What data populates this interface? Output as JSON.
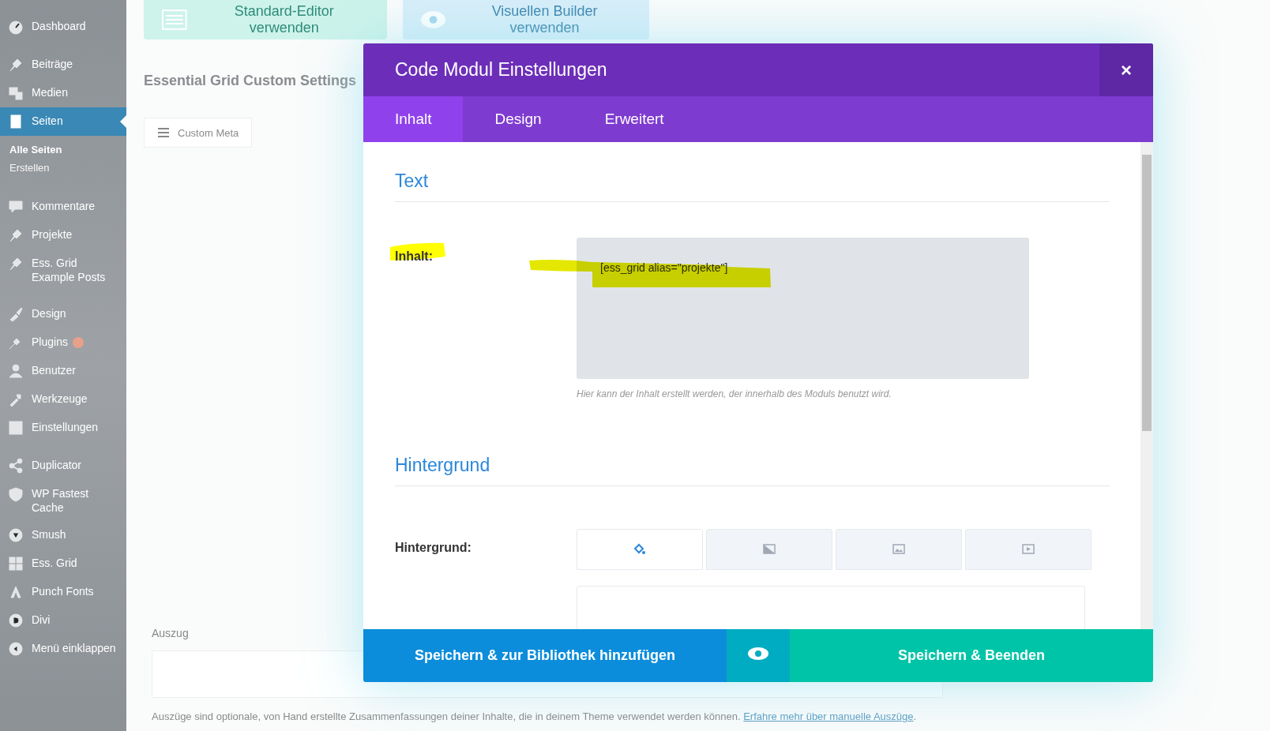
{
  "sidebar": {
    "items": [
      {
        "label": "Dashboard",
        "selected": false
      },
      {
        "label": "Beiträge",
        "selected": false
      },
      {
        "label": "Medien",
        "selected": false
      },
      {
        "label": "Seiten",
        "selected": true,
        "children": [
          {
            "label": "Alle Seiten",
            "selected": true
          },
          {
            "label": "Erstellen",
            "selected": false
          }
        ]
      },
      {
        "label": "Kommentare",
        "selected": false
      },
      {
        "label": "Projekte",
        "selected": false
      },
      {
        "label": "Ess. Grid Example Posts",
        "selected": false
      },
      {
        "label": "Design",
        "selected": false
      },
      {
        "label": "Plugins",
        "selected": false
      },
      {
        "label": "Benutzer",
        "selected": false
      },
      {
        "label": "Werkzeuge",
        "selected": false
      },
      {
        "label": "Einstellungen",
        "selected": false
      },
      {
        "label": "Duplicator",
        "selected": false
      },
      {
        "label": "WP Fastest Cache",
        "selected": false
      },
      {
        "label": "Smush",
        "selected": false
      },
      {
        "label": "Ess. Grid",
        "selected": false
      },
      {
        "label": "Punch Fonts",
        "selected": false
      },
      {
        "label": "Divi",
        "selected": false
      },
      {
        "label": "Menü einklappen",
        "selected": false
      }
    ]
  },
  "editor_buttons": [
    {
      "kind": "standard",
      "label": "Standard-Editor verwenden"
    },
    {
      "kind": "visual",
      "label": "Visuellen Builder verwenden"
    }
  ],
  "page": {
    "heading": "Essential Grid Custom Settings",
    "meta_tab": "Custom Meta",
    "excerpt": {
      "title": "Auszug",
      "help": "Auszüge sind optionale, von Hand erstellte Zusammenfassungen deiner Inhalte, die in deinem Theme verwendet werden können.",
      "link": "Erfahre mehr über manuelle Auszüge",
      "help_end": "."
    }
  },
  "modal": {
    "title": "Code Modul Einstellungen",
    "close": "×",
    "tabs": [
      {
        "label": "Inhalt",
        "selected": true
      },
      {
        "label": "Design",
        "selected": false
      },
      {
        "label": "Erweitert",
        "selected": false
      }
    ],
    "sections": [
      {
        "title": "Text",
        "fields": [
          {
            "kind": "code",
            "label": "Inhalt:",
            "value": "[ess_grid alias=\"projekte\"]",
            "help": "Hier kann der Inhalt erstellt werden, der innerhalb des Moduls benutzt wird.",
            "highlighted": true
          }
        ]
      },
      {
        "title": "Hintergrund",
        "fields": [
          {
            "kind": "background",
            "label": "Hintergrund:",
            "options": [
              {
                "kind": "color",
                "selected": true
              },
              {
                "kind": "gradient",
                "selected": false
              },
              {
                "kind": "image",
                "selected": false
              },
              {
                "kind": "video",
                "selected": false
              }
            ]
          }
        ]
      }
    ],
    "footer": [
      {
        "kind": "library",
        "label": "Speichern & zur Bibliothek hinzufügen"
      },
      {
        "kind": "preview"
      },
      {
        "kind": "save",
        "label": "Speichern & Beenden"
      }
    ]
  }
}
